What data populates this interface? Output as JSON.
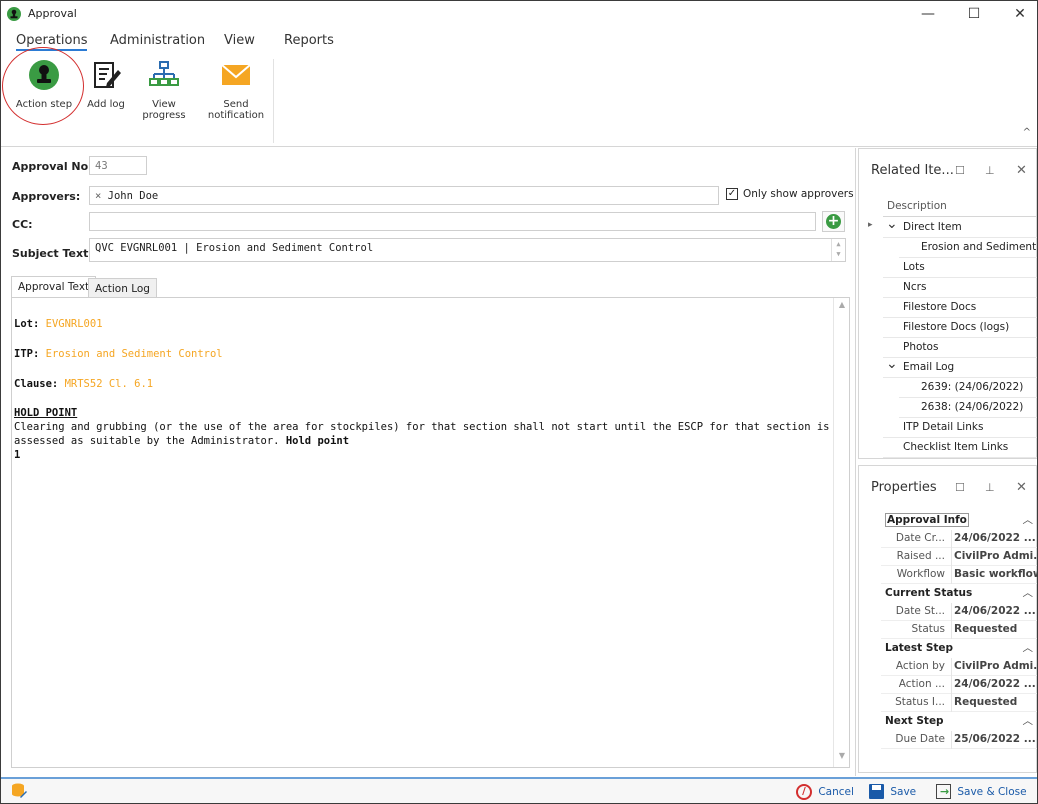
{
  "window": {
    "title": "Approval",
    "minimize": "—",
    "maximize": "☐",
    "close": "✕"
  },
  "menu": {
    "tabs": [
      "Operations",
      "Administration",
      "View",
      "Reports"
    ]
  },
  "ribbon": {
    "action_step": "Action step",
    "add_log": "Add log",
    "view_progress": "View progress",
    "send_notification_1": "Send",
    "send_notification_2": "notification"
  },
  "form": {
    "approval_no_label": "Approval No:",
    "approval_no": "43",
    "approvers_label": "Approvers:",
    "approver_chip": "John  Doe",
    "only_show_approvers": "Only show approvers",
    "cc_label": "CC:",
    "subject_label": "Subject Text:",
    "subject": "QVC EVGNRL001 | Erosion and Sediment Control"
  },
  "tabs": {
    "approval_text": "Approval Text",
    "action_log": "Action Log"
  },
  "editor": {
    "lot_label": "Lot:",
    "lot_value": "EVGNRL001",
    "itp_label": "ITP:",
    "itp_value": "Erosion and Sediment Control",
    "clause_label": "Clause:",
    "clause_value": "MRTS52 Cl. 6.1",
    "hold_heading": "HOLD POINT",
    "hold_text": "Clearing and grubbing (or the use of the area for stockpiles) for that section shall not start until the ESCP for that section is assessed as suitable by the Administrator.",
    "hold_suffix": "Hold point",
    "hold_num": "1"
  },
  "related": {
    "title": "Related Ite...",
    "column": "Description",
    "items": [
      {
        "label": "Direct Item",
        "indent": 1,
        "caret": "expanded"
      },
      {
        "label": "Erosion and Sediment ...",
        "indent": 2,
        "caret": ""
      },
      {
        "label": "Lots",
        "indent": 1,
        "caret": ""
      },
      {
        "label": "Ncrs",
        "indent": 1,
        "caret": ""
      },
      {
        "label": "Filestore Docs",
        "indent": 1,
        "caret": ""
      },
      {
        "label": "Filestore Docs (logs)",
        "indent": 1,
        "caret": ""
      },
      {
        "label": "Photos",
        "indent": 1,
        "caret": ""
      },
      {
        "label": "Email Log",
        "indent": 1,
        "caret": "expanded"
      },
      {
        "label": "2639: (24/06/2022)",
        "indent": 2,
        "caret": ""
      },
      {
        "label": "2638: (24/06/2022)",
        "indent": 2,
        "caret": ""
      },
      {
        "label": "ITP Detail Links",
        "indent": 1,
        "caret": ""
      },
      {
        "label": "Checklist Item Links",
        "indent": 1,
        "caret": ""
      }
    ]
  },
  "properties": {
    "title": "Properties",
    "groups": [
      {
        "name": "Approval Info",
        "rows": [
          {
            "k": "Date Cr...",
            "v": "24/06/2022 ..."
          },
          {
            "k": "Raised ...",
            "v": "CivilPro Admi..."
          },
          {
            "k": "Workflow",
            "v": "Basic workflow"
          }
        ]
      },
      {
        "name": "Current Status",
        "rows": [
          {
            "k": "Date St...",
            "v": "24/06/2022 ..."
          },
          {
            "k": "Status",
            "v": "Requested"
          }
        ]
      },
      {
        "name": "Latest Step",
        "rows": [
          {
            "k": "Action by",
            "v": "CivilPro Admi..."
          },
          {
            "k": "Action ...",
            "v": "24/06/2022 ..."
          },
          {
            "k": "Status I...",
            "v": "Requested"
          }
        ]
      },
      {
        "name": "Next Step",
        "rows": [
          {
            "k": "Due Date",
            "v": "25/06/2022 ..."
          }
        ]
      }
    ]
  },
  "footer": {
    "cancel": "Cancel",
    "save": "Save",
    "save_close": "Save & Close"
  },
  "colors": {
    "accent": "#2b7bd4",
    "link_orange": "#f5a623",
    "green": "#3a9b43",
    "cancel_red": "#d32f2f"
  }
}
